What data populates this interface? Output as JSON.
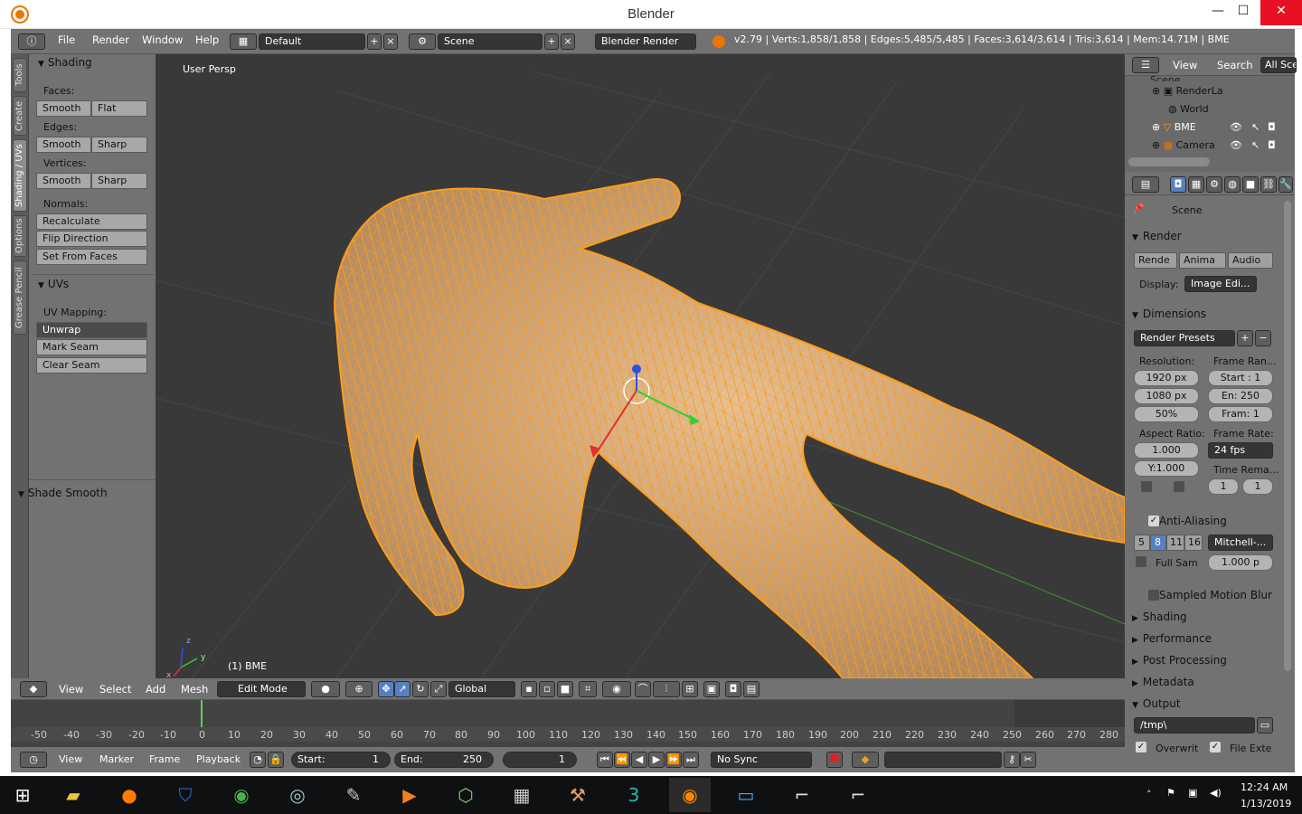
{
  "window": {
    "title": "Blender",
    "min": "—",
    "max": "☐",
    "close": "✕"
  },
  "info_header": {
    "menus": [
      "File",
      "Render",
      "Window",
      "Help"
    ],
    "layout": "Default",
    "scene": "Scene",
    "engine": "Blender Render",
    "stats": "v2.79 | Verts:1,858/1,858 | Edges:5,485/5,485 | Faces:3,614/3,614 | Tris:3,614 | Mem:14.71M | BME"
  },
  "tool_tabs": [
    "Tools",
    "Create",
    "Shading / UVs",
    "Options",
    "Grease Pencil"
  ],
  "tool_panel": {
    "shading_header": "Shading",
    "faces_label": "Faces:",
    "edges_label": "Edges:",
    "vertices_label": "Vertices:",
    "normals_label": "Normals:",
    "smooth": "Smooth",
    "flat": "Flat",
    "sharp": "Sharp",
    "recalculate": "Recalculate",
    "flip_direction": "Flip Direction",
    "set_from_faces": "Set From Faces",
    "uvs_header": "UVs",
    "uv_mapping_label": "UV Mapping:",
    "unwrap": "Unwrap",
    "mark_seam": "Mark Seam",
    "clear_seam": "Clear Seam",
    "operator_header": "Shade Smooth"
  },
  "viewport": {
    "view_name": "User Persp",
    "object_label": "(1) BME",
    "axis_x": "x",
    "axis_y": "y",
    "axis_z": "z"
  },
  "view3d_header": {
    "menus": [
      "View",
      "Select",
      "Add",
      "Mesh"
    ],
    "mode": "Edit Mode",
    "orientation": "Global"
  },
  "outliner": {
    "menus": [
      "View",
      "Search"
    ],
    "filter": "All Sce",
    "items": [
      "Scene",
      "RenderLa",
      "World",
      "BME",
      "Camera"
    ]
  },
  "properties": {
    "scene_label": "Scene",
    "render_header": "Render",
    "render_btn": "Rende",
    "anim_btn": "Anima",
    "audio_btn": "Audio",
    "display_label": "Display:",
    "display_value": "Image Edi...",
    "dimensions_header": "Dimensions",
    "render_presets": "Render Presets",
    "resolution_label": "Resolution:",
    "res_x": "1920 px",
    "res_y": "1080 px",
    "res_pct": "50%",
    "frame_range_label": "Frame Ran...",
    "start": "Start : 1",
    "end": "En:  250",
    "frame": "Fram:  1",
    "aspect_label": "Aspect Ratio:",
    "aspect_x": "1.000",
    "aspect_y": "Y:1.000",
    "frame_rate_label": "Frame Rate:",
    "fps": "24 fps",
    "time_remap_label": "Time Rema...",
    "remap_old": "1",
    "remap_new": "1",
    "aa_header": "Anti-Aliasing",
    "aa_samples": [
      "5",
      "8",
      "11",
      "16"
    ],
    "aa_filter": "Mitchell-...",
    "full_sample": "Full Sam",
    "filter_size": "1.000 p",
    "motion_blur": "Sampled Motion Blur",
    "shading": "Shading",
    "performance": "Performance",
    "post_processing": "Post Processing",
    "metadata": "Metadata",
    "output": "Output",
    "output_path": "/tmp\\",
    "overwrite": "Overwrit",
    "file_ext": "File Exte"
  },
  "timeline": {
    "ticks": [
      "-50",
      "-40",
      "-30",
      "-20",
      "-10",
      "0",
      "10",
      "20",
      "30",
      "40",
      "50",
      "60",
      "70",
      "80",
      "90",
      "100",
      "110",
      "120",
      "130",
      "140",
      "150",
      "160",
      "170",
      "180",
      "190",
      "200",
      "210",
      "220",
      "230",
      "240",
      "250",
      "260",
      "270",
      "280"
    ],
    "menus": [
      "View",
      "Marker",
      "Frame",
      "Playback"
    ],
    "start_label": "Start:",
    "start_val": "1",
    "end_label": "End:",
    "end_val": "250",
    "current": "1",
    "sync": "No Sync"
  },
  "taskbar": {
    "time": "12:24 AM",
    "date": "1/13/2019"
  },
  "colors": {
    "mesh_wire": "#ff9d1a",
    "mesh_fill": "#d4a472",
    "accent": "#5680c2"
  }
}
